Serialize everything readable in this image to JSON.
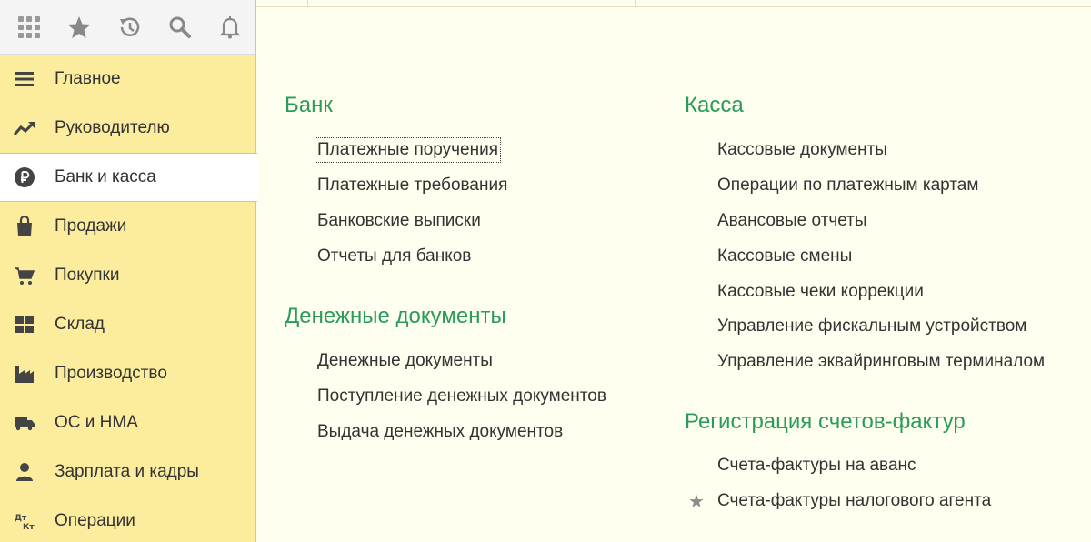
{
  "colors": {
    "accent": "#2a9b5b",
    "sidebar_bg": "#fbec9e",
    "content_bg": "#fffff0"
  },
  "toolbar": {
    "icons": [
      "apps-grid-icon",
      "star-icon",
      "history-icon",
      "search-icon",
      "bell-icon"
    ]
  },
  "sidebar": {
    "items": [
      {
        "label": "Главное",
        "icon": "menu-lines-icon"
      },
      {
        "label": "Руководителю",
        "icon": "trend-up-icon"
      },
      {
        "label": "Банк и касса",
        "icon": "ruble-icon"
      },
      {
        "label": "Продажи",
        "icon": "shopping-bag-icon"
      },
      {
        "label": "Покупки",
        "icon": "cart-icon"
      },
      {
        "label": "Склад",
        "icon": "warehouse-grid-icon"
      },
      {
        "label": "Производство",
        "icon": "factory-icon"
      },
      {
        "label": "ОС и НМА",
        "icon": "truck-icon"
      },
      {
        "label": "Зарплата и кадры",
        "icon": "person-icon"
      },
      {
        "label": "Операции",
        "icon": "dt-kt-icon"
      }
    ],
    "active_index": 2
  },
  "content": {
    "bank": {
      "title": "Банк",
      "links": [
        "Платежные поручения",
        "Платежные требования",
        "Банковские выписки",
        "Отчеты для банков"
      ]
    },
    "money_docs": {
      "title": "Денежные документы",
      "links": [
        "Денежные документы",
        "Поступление денежных документов",
        "Выдача денежных документов"
      ]
    },
    "kassa": {
      "title": "Касса",
      "links": [
        "Кассовые документы",
        "Операции по платежным картам",
        "Авансовые отчеты",
        "Кассовые смены",
        "Кассовые чеки коррекции",
        "Управление фискальным устройством",
        "Управление эквайринговым терминалом"
      ]
    },
    "invoices": {
      "title": "Регистрация счетов-фактур",
      "links": [
        "Счета-фактуры на аванс",
        "Счета-фактуры налогового агента"
      ]
    }
  }
}
